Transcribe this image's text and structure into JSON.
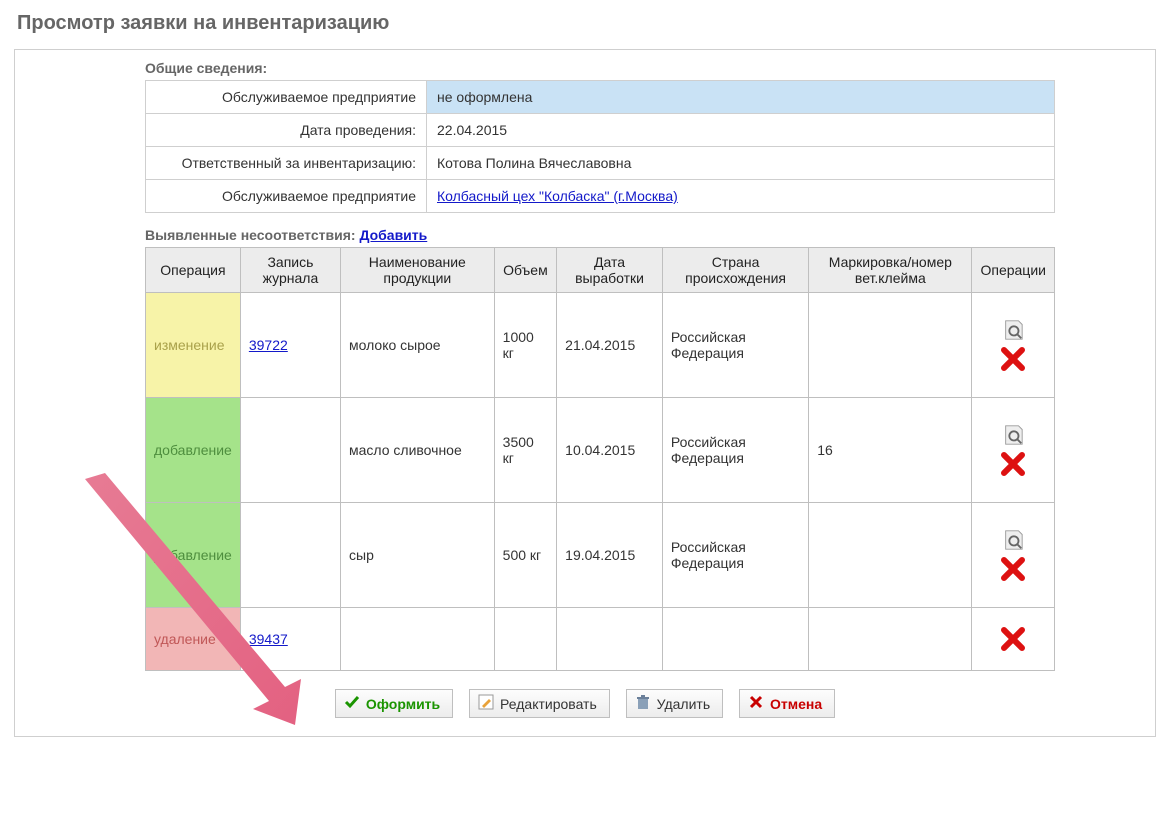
{
  "title": "Просмотр заявки на инвентаризацию",
  "general": {
    "header": "Общие сведения:",
    "rows": {
      "enterprise_label": "Обслуживаемое предприятие",
      "enterprise_value": "не оформлена",
      "date_label": "Дата проведения:",
      "date_value": "22.04.2015",
      "responsible_label": "Ответственный за инвентаризацию:",
      "responsible_value": "Котова Полина Вячеславовна",
      "enterprise2_label": "Обслуживаемое предприятие",
      "enterprise2_value": "Колбасный цех \"Колбаска\" (г.Москва)"
    }
  },
  "discrepancies": {
    "header": "Выявленные несоответствия:",
    "add_link": "Добавить",
    "columns": {
      "operation": "Операция",
      "journal": "Запись журнала",
      "product": "Наименование продукции",
      "volume": "Объем",
      "proddate": "Дата выработки",
      "country": "Страна происхождения",
      "marking": "Маркировка/номер вет.клейма",
      "actions": "Операции"
    },
    "rows": [
      {
        "op": "изменение",
        "op_cls": "op-change",
        "journal": "39722",
        "product": "молоко сырое",
        "volume": "1000 кг",
        "date": "21.04.2015",
        "country": "Российская Федерация",
        "marking": "",
        "has_mag": true
      },
      {
        "op": "добавление",
        "op_cls": "op-add",
        "journal": "",
        "product": "масло сливочное",
        "volume": "3500 кг",
        "date": "10.04.2015",
        "country": "Российская Федерация",
        "marking": "16",
        "has_mag": true
      },
      {
        "op": "добавление",
        "op_cls": "op-add",
        "journal": "",
        "product": "сыр",
        "volume": "500 кг",
        "date": "19.04.2015",
        "country": "Российская Федерация",
        "marking": "",
        "has_mag": true
      },
      {
        "op": "удаление",
        "op_cls": "op-del",
        "journal": "39437",
        "product": "",
        "volume": "",
        "date": "",
        "country": "",
        "marking": "",
        "has_mag": false,
        "short": true
      }
    ]
  },
  "buttons": {
    "submit": "Оформить",
    "edit": "Редактировать",
    "delete": "Удалить",
    "cancel": "Отмена"
  }
}
